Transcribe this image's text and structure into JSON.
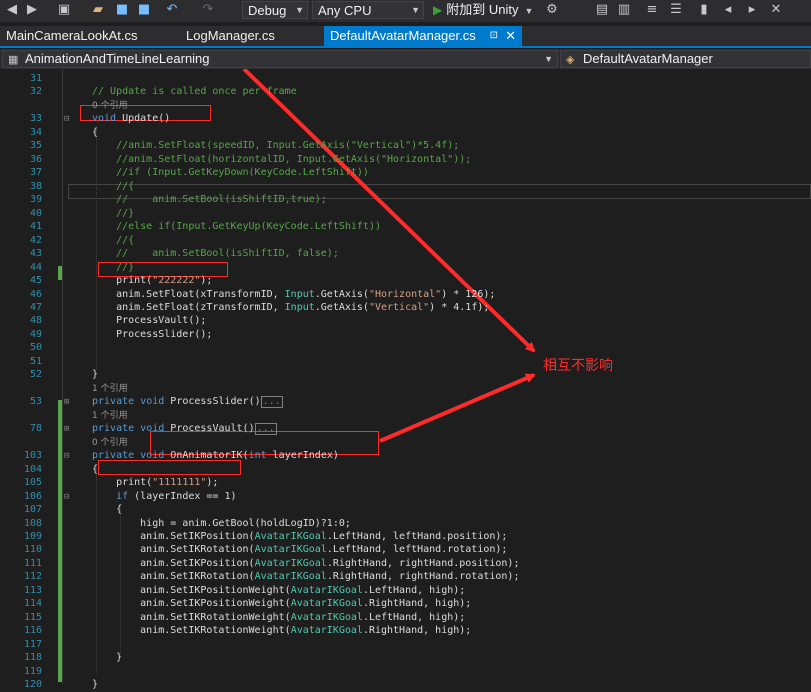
{
  "toolbar": {
    "config": "Debug",
    "platform": "Any CPU",
    "run_label": "附加到 Unity",
    "icons": [
      "undo-icon",
      "redo-icon",
      "new-project-icon",
      "open-folder-icon",
      "save-icon",
      "save-all-icon",
      "play-icon",
      "breakpoint-icon",
      "bookmark-icon"
    ]
  },
  "tabs": [
    {
      "label": "MainCameraLookAt.cs",
      "active": false
    },
    {
      "label": "LogManager.cs",
      "active": false
    },
    {
      "label": "DefaultAvatarManager.cs",
      "active": true
    }
  ],
  "tab_close_glyph": "✕",
  "tab_pin_glyph": "⊡",
  "navbar": {
    "project": "AnimationAndTimeLineLearning",
    "class": "DefaultAvatarManager"
  },
  "code": {
    "lines": [
      {
        "n": "31",
        "text": ""
      },
      {
        "n": "32",
        "text": "// Update is called once per frame"
      },
      {
        "n": "",
        "text": "0 个引用"
      },
      {
        "n": "33",
        "text": "void Update()"
      },
      {
        "n": "34",
        "text": "{"
      },
      {
        "n": "35",
        "text": "    //anim.SetFloat(speedID, Input.GetAxis(\"Vertical\")*5.4f);"
      },
      {
        "n": "36",
        "text": "    //anim.SetFloat(horizontalID, Input.GetAxis(\"Horizontal\"));"
      },
      {
        "n": "37",
        "text": "    //if (Input.GetKeyDown(KeyCode.LeftShift))"
      },
      {
        "n": "38",
        "text": "    //{"
      },
      {
        "n": "39",
        "text": "    //    anim.SetBool(isShiftID,true);"
      },
      {
        "n": "40",
        "text": "    //}"
      },
      {
        "n": "41",
        "text": "    //else if(Input.GetKeyUp(KeyCode.LeftShift))"
      },
      {
        "n": "42",
        "text": "    //{"
      },
      {
        "n": "43",
        "text": "    //    anim.SetBool(isShiftID, false);"
      },
      {
        "n": "44",
        "text": "    //}"
      },
      {
        "n": "45",
        "text": "    print(\"222222\");"
      },
      {
        "n": "46",
        "text": "    anim.SetFloat(xTransformID, Input.GetAxis(\"Horizontal\") * 126);"
      },
      {
        "n": "47",
        "text": "    anim.SetFloat(zTransformID, Input.GetAxis(\"Vertical\") * 4.1f);"
      },
      {
        "n": "48",
        "text": "    ProcessVault();"
      },
      {
        "n": "49",
        "text": "    ProcessSlider();"
      },
      {
        "n": "50",
        "text": ""
      },
      {
        "n": "51",
        "text": ""
      },
      {
        "n": "52",
        "text": "}"
      },
      {
        "n": "",
        "text": "1 个引用"
      },
      {
        "n": "53",
        "text": "private void ProcessSlider()"
      },
      {
        "n": "",
        "text": "1 个引用"
      },
      {
        "n": "78",
        "text": "private void ProcessVault()"
      },
      {
        "n": "",
        "text": "0 个引用"
      },
      {
        "n": "103",
        "text": "private void OnAnimatorIK(int layerIndex)"
      },
      {
        "n": "104",
        "text": "{"
      },
      {
        "n": "105",
        "text": "    print(\"1111111\");"
      },
      {
        "n": "106",
        "text": "    if (layerIndex == 1)"
      },
      {
        "n": "107",
        "text": "    {"
      },
      {
        "n": "108",
        "text": "        high = anim.GetBool(holdLogID)?1:0;"
      },
      {
        "n": "109",
        "text": "        anim.SetIKPosition(AvatarIKGoal.LeftHand, leftHand.position);"
      },
      {
        "n": "110",
        "text": "        anim.SetIKRotation(AvatarIKGoal.LeftHand, leftHand.rotation);"
      },
      {
        "n": "111",
        "text": "        anim.SetIKPosition(AvatarIKGoal.RightHand, rightHand.position);"
      },
      {
        "n": "112",
        "text": "        anim.SetIKRotation(AvatarIKGoal.RightHand, rightHand.rotation);"
      },
      {
        "n": "113",
        "text": "        anim.SetIKPositionWeight(AvatarIKGoal.LeftHand, high);"
      },
      {
        "n": "114",
        "text": "        anim.SetIKPositionWeight(AvatarIKGoal.RightHand, high);"
      },
      {
        "n": "115",
        "text": "        anim.SetIKRotationWeight(AvatarIKGoal.LeftHand, high);"
      },
      {
        "n": "116",
        "text": "        anim.SetIKRotationWeight(AvatarIKGoal.RightHand, high);"
      },
      {
        "n": "117",
        "text": ""
      },
      {
        "n": "118",
        "text": "    }"
      },
      {
        "n": "119",
        "text": ""
      },
      {
        "n": "120",
        "text": "}"
      }
    ]
  },
  "annotation": {
    "text": "相互不影响",
    "color": "#ff2a2a"
  },
  "colors": {
    "keyword": "#569cd6",
    "type": "#4ec9b0",
    "string": "#d69d85",
    "comment": "#57a64a",
    "line_number": "#2b91af",
    "accent": "#007acc"
  }
}
